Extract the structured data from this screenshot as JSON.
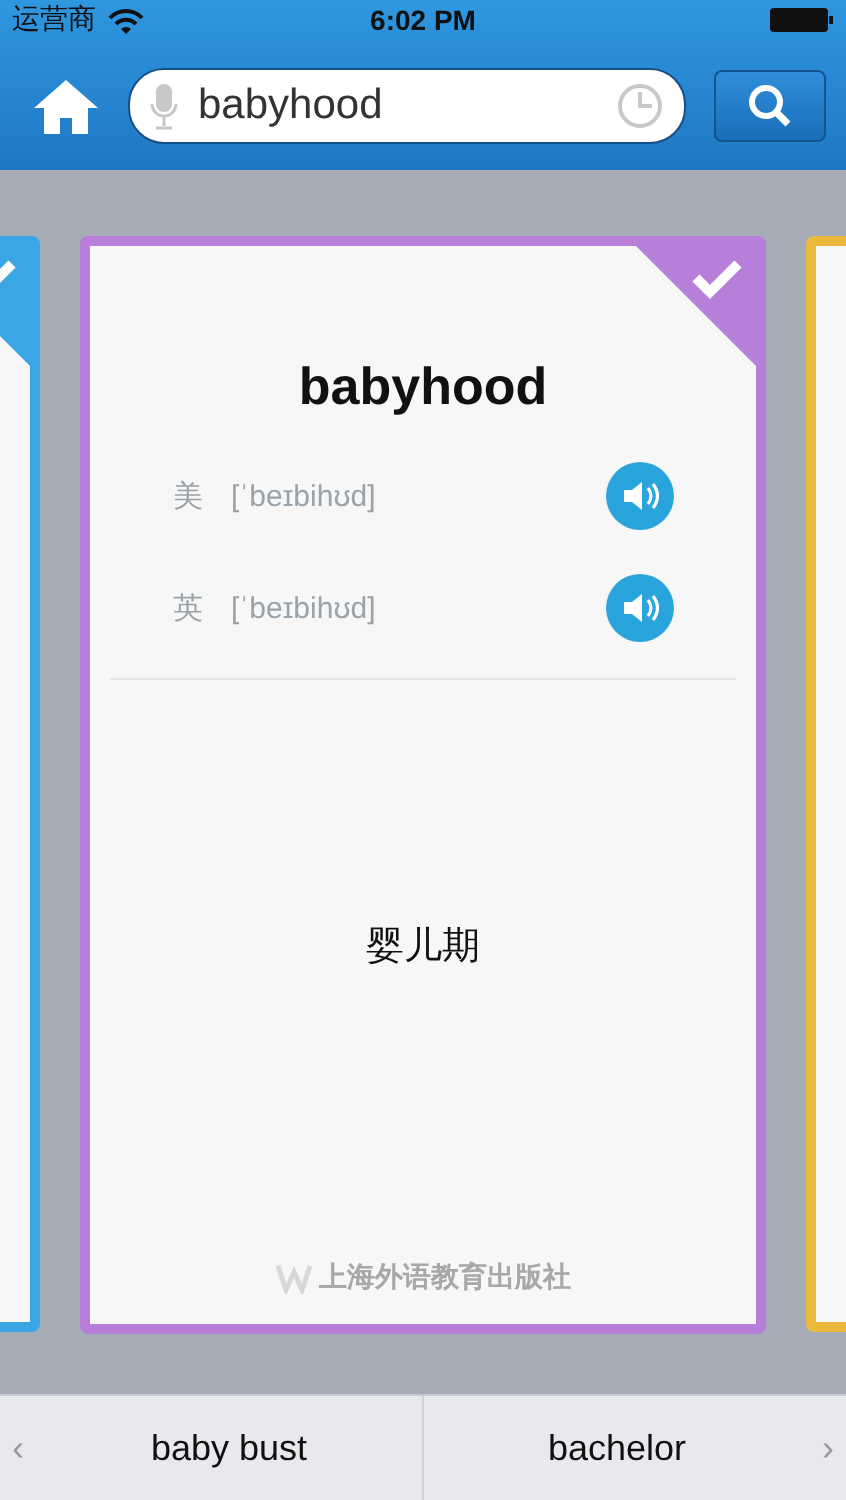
{
  "status_bar": {
    "carrier": "运营商",
    "time": "6:02 PM"
  },
  "search": {
    "value": "babyhood"
  },
  "cards": [
    {
      "kind": "side",
      "color": "#3aa6e4",
      "checked": true
    },
    {
      "kind": "main",
      "color": "#b77fd9",
      "checked": true,
      "word": "babyhood",
      "pronunciations": [
        {
          "label": "美",
          "phonetic": "[ˈbeɪbihʊd]"
        },
        {
          "label": "英",
          "phonetic": "[ˈbeɪbihʊd]"
        }
      ],
      "meaning": "婴儿期",
      "publisher": "上海外语教育出版社"
    },
    {
      "kind": "side",
      "color": "#e9b93c"
    }
  ],
  "bottom_nav": {
    "prev_arrow": "‹",
    "prev": "baby bust",
    "next": "bachelor",
    "next_arrow": "›"
  }
}
